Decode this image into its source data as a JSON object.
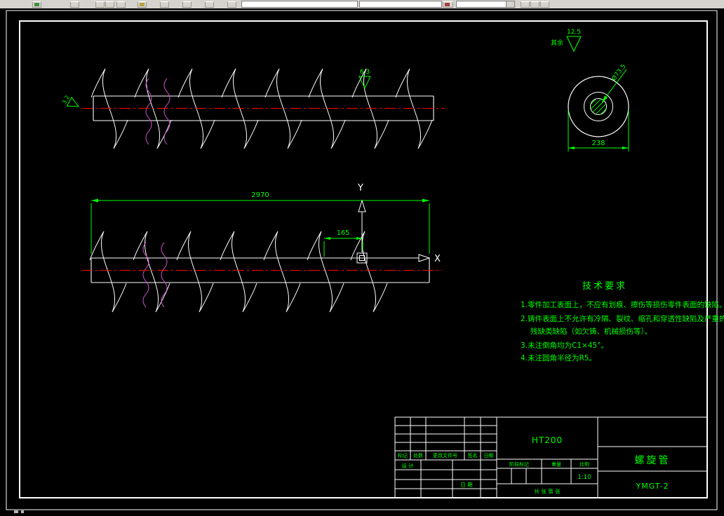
{
  "colors": {
    "line": "#ffffff",
    "annotation": "#00ff00",
    "centerline": "#ff0000",
    "breakline": "#c94fc9",
    "toolbar_bg": "#d6d3ce",
    "canvas_bg": "#000000"
  },
  "ucs": {
    "x": "X",
    "y": "Y"
  },
  "dimensions": {
    "overall_length": "2970",
    "pitch": "165",
    "outer_diameter": "238",
    "bore_diameter": "Ø73.5"
  },
  "roughness": {
    "left_value": "3.2",
    "flight_value": "6.3",
    "general_prefix": "其余",
    "general_value": "12.5"
  },
  "tech_requirements": {
    "title": "技术要求",
    "lines": [
      "1.零件加工表面上，不应有划痕、擦伤等损伤零件表面的缺陷。",
      "2.铸件表面上不允许有冷隔、裂纹、缩孔和穿透性缺陷及严重的",
      "残缺类缺陷（如欠铸、机械损伤等）。",
      "3.未注倒角均为C1×45°。",
      "4.未注圆角半径为R5。"
    ]
  },
  "title_block": {
    "material": "HT200",
    "part_name": "螺旋管",
    "drawing_number": "YMGT-2",
    "scale": "1:10",
    "headers": {
      "mark": "标记",
      "count": "处数",
      "file": "更改文件号",
      "sign": "签名",
      "date": "日期"
    },
    "design_label": "设 计",
    "date_label": "日 期",
    "stage_label": "阶段标记",
    "weight_label": "重量",
    "scale_label": "比例",
    "sheet_label": "共  张  第  张"
  }
}
